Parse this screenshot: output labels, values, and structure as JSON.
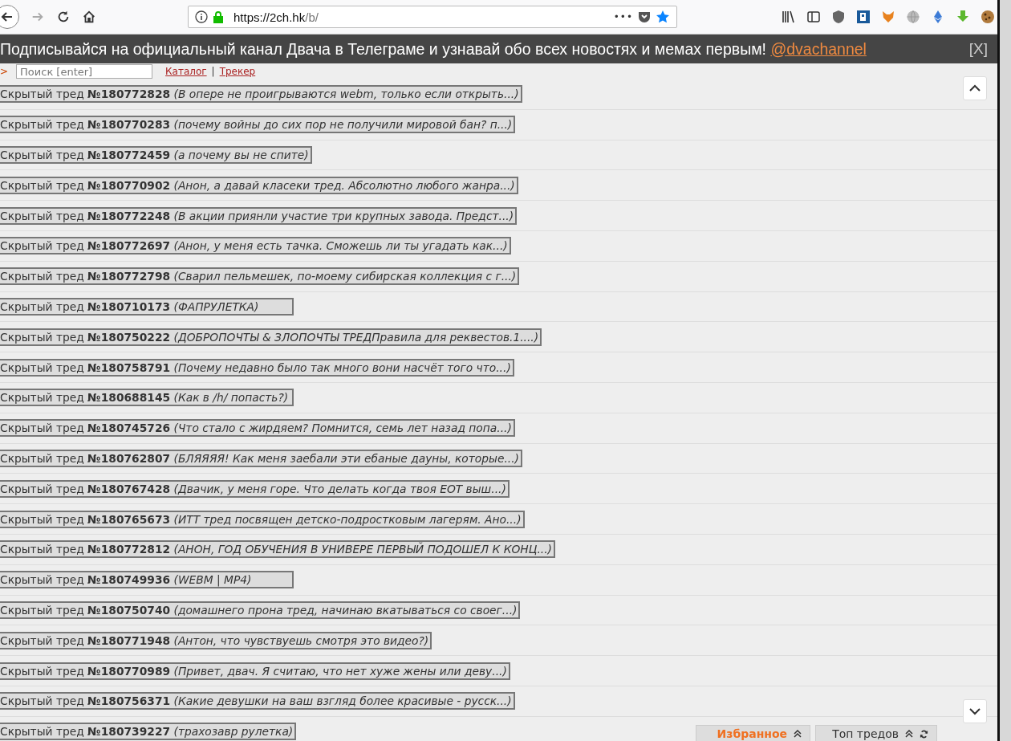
{
  "browser": {
    "url_host": "https://2ch.hk",
    "url_path": "/b/",
    "menu_dots": "•••"
  },
  "banner": {
    "text": "Подписывайся на официальный канал Двача в Телеграме и узнавай обо всех новостях и мемах первым!",
    "link": "@dvachannel",
    "close": "[X]"
  },
  "search": {
    "arrow": ">",
    "placeholder": "Поиск [enter]",
    "links": [
      "Каталог",
      "Трекер"
    ],
    "separator": "|"
  },
  "threads": [
    {
      "label": "Скрытый тред",
      "number": "№180772828",
      "subject": "(В опере не проигрываются webm, только если открыть...)"
    },
    {
      "label": "Скрытый тред",
      "number": "№180770283",
      "subject": "(почему войны до сих пор не получили мировой бан? п...)"
    },
    {
      "label": "Скрытый тред",
      "number": "№180772459",
      "subject": "(а почему вы не спите)"
    },
    {
      "label": "Скрытый тред",
      "number": "№180770902",
      "subject": "(Анон, а давай класеки тред. Абсолютно любого жанра...)"
    },
    {
      "label": "Скрытый тред",
      "number": "№180772248",
      "subject": "(В акции приянли участие три крупных завода. Предст...)"
    },
    {
      "label": "Скрытый тред",
      "number": "№180772697",
      "subject": "(Анон, у меня есть тачка. Сможешь ли ты угадать как...)"
    },
    {
      "label": "Скрытый тред",
      "number": "№180772798",
      "subject": "(Сварил пельмешек, по-моему сибирская коллекция с г...)"
    },
    {
      "label": "Скрытый тред",
      "number": "№180710173",
      "subject": "(ФАПРУЛЕТКА)"
    },
    {
      "label": "Скрытый тред",
      "number": "№180750222",
      "subject": "(ДОБРОПОЧТЫ & ЗЛОПОЧТЫ ТРЕДПравила для реквестов.1....)"
    },
    {
      "label": "Скрытый тред",
      "number": "№180758791",
      "subject": "(Почему недавно было так много вони насчёт того что...)"
    },
    {
      "label": "Скрытый тред",
      "number": "№180688145",
      "subject": "(Как в /h/ попасть?)"
    },
    {
      "label": "Скрытый тред",
      "number": "№180745726",
      "subject": "(Что стало с жирдяем? Помнится, семь лет назад попа...)"
    },
    {
      "label": "Скрытый тред",
      "number": "№180762807",
      "subject": "(БЛЯЯЯЯ! Как меня заебали эти ебаные дауны, которые...)"
    },
    {
      "label": "Скрытый тред",
      "number": "№180767428",
      "subject": "(Двачик, у меня горе. Что делать когда твоя ЕОТ выш...)"
    },
    {
      "label": "Скрытый тред",
      "number": "№180765673",
      "subject": "(ИТТ тред посвящен детско-подростковым лагерям. Ано...)"
    },
    {
      "label": "Скрытый тред",
      "number": "№180772812",
      "subject": "(АНОН, ГОД ОБУЧЕНИЯ В УНИВЕРЕ ПЕРВЫЙ ПОДОШЕЛ К КОНЦ...)"
    },
    {
      "label": "Скрытый тред",
      "number": "№180749936",
      "subject": "(WEBM | MP4)"
    },
    {
      "label": "Скрытый тред",
      "number": "№180750740",
      "subject": "(домашнего прона тред, начинаю вкатываться со своег...)"
    },
    {
      "label": "Скрытый тред",
      "number": "№180771948",
      "subject": "(Антон, что чувствуешь смотря это видео?)"
    },
    {
      "label": "Скрытый тред",
      "number": "№180770989",
      "subject": "(Привет, двач. Я считаю, что нет хуже жены или деву...)"
    },
    {
      "label": "Скрытый тред",
      "number": "№180756371",
      "subject": "(Какие девушки на ваш взгляд более красивые - русск...)"
    },
    {
      "label": "Скрытый тред",
      "number": "№180739227",
      "subject": "(трахозавр рулетка)"
    }
  ],
  "bottom_tabs": [
    {
      "label": "Избранное",
      "kind": "favorites"
    },
    {
      "label": "Топ тредов",
      "kind": "top"
    }
  ]
}
